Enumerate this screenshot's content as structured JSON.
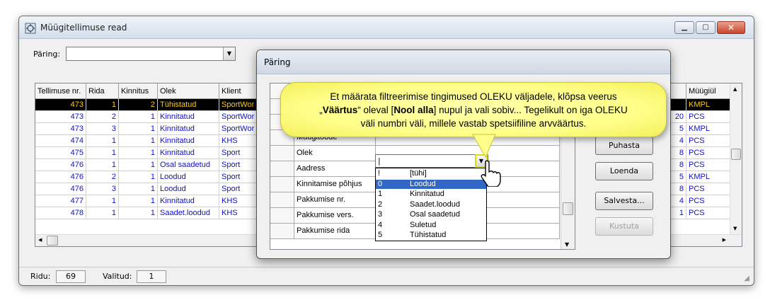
{
  "window": {
    "title": "Müügitellimuse read"
  },
  "query": {
    "label": "Päring:",
    "value": ""
  },
  "grid": {
    "columns": [
      "Tellimuse nr.",
      "Rida",
      "Kinnitus",
      "Olek",
      "Klient",
      "",
      "Müügiül"
    ],
    "rows": [
      {
        "order": "473",
        "line": "1",
        "conf": "2",
        "state": "Tühistatud",
        "client": "SportWor",
        "qty": "",
        "seller": "KMPL"
      },
      {
        "order": "473",
        "line": "2",
        "conf": "1",
        "state": "Kinnitatud",
        "client": "SportWor",
        "qty": "20",
        "seller": "PCS"
      },
      {
        "order": "473",
        "line": "3",
        "conf": "1",
        "state": "Kinnitatud",
        "client": "SportWor",
        "qty": "5",
        "seller": "KMPL"
      },
      {
        "order": "474",
        "line": "1",
        "conf": "1",
        "state": "Kinnitatud",
        "client": "KHS",
        "qty": "4",
        "seller": "PCS"
      },
      {
        "order": "475",
        "line": "1",
        "conf": "1",
        "state": "Kinnitatud",
        "client": "Sport",
        "qty": "8",
        "seller": "PCS"
      },
      {
        "order": "476",
        "line": "1",
        "conf": "1",
        "state": "Osal saadetud",
        "client": "Sport",
        "qty": "8",
        "seller": "PCS"
      },
      {
        "order": "476",
        "line": "2",
        "conf": "1",
        "state": "Loodud",
        "client": "Sport",
        "qty": "5",
        "seller": "KMPL"
      },
      {
        "order": "476",
        "line": "3",
        "conf": "1",
        "state": "Loodud",
        "client": "Sport",
        "qty": "8",
        "seller": "PCS"
      },
      {
        "order": "477",
        "line": "1",
        "conf": "1",
        "state": "Kinnitatud",
        "client": "KHS",
        "qty": "4",
        "seller": "PCS"
      },
      {
        "order": "478",
        "line": "1",
        "conf": "1",
        "state": "Saadet.loodud",
        "client": "KHS",
        "qty": "1",
        "seller": "PCS"
      }
    ]
  },
  "status": {
    "rows_label": "Ridu:",
    "rows_value": "69",
    "selected_label": "Valitud:",
    "selected_value": "1"
  },
  "dialog": {
    "title": "Päring",
    "fields": [
      "Müügitoode",
      "Olek",
      "Aadress",
      "Kinnitamise põhjus",
      "Pakkumise nr.",
      "Pakkumise vers.",
      "Pakkumise rida"
    ],
    "olek_value": "|",
    "buttons": {
      "clear": "Puhasta",
      "read": "Loenda",
      "save": "Salvesta...",
      "delete": "Kustuta"
    },
    "dropdown": [
      {
        "key": "!",
        "label": "[tühi]"
      },
      {
        "key": "0",
        "label": "Loodud"
      },
      {
        "key": "1",
        "label": "Kinnitatud"
      },
      {
        "key": "2",
        "label": "Saadet.loodud"
      },
      {
        "key": "3",
        "label": "Osal saadetud"
      },
      {
        "key": "4",
        "label": "Suletud"
      },
      {
        "key": "5",
        "label": "Tühistatud"
      }
    ]
  },
  "callout": {
    "p1": "Et määrata filtreerimise tingimused OLEKU väljadele, klõpsa veerus",
    "q1": "„",
    "b1": "Väärtus",
    "p2": "“ oleval [",
    "b2": "Nool alla",
    "p3": "] nupul ja vali sobiv... Tegelikult on iga OLEKU",
    "p4": "väli numbri väli, millele vastab spetsiifiline arvväärtus."
  },
  "colors": {
    "selected_row_bg": "#000000",
    "selected_row_fg": "#ffcc00",
    "cell_text": "#1010cc",
    "dropdown_highlight": "#3168c6",
    "callout": "#ffff8a"
  },
  "icons": [
    "app-icon",
    "minimize-icon",
    "maximize-icon",
    "close-icon",
    "dropdown-arrow-icon",
    "hand-cursor-icon"
  ]
}
